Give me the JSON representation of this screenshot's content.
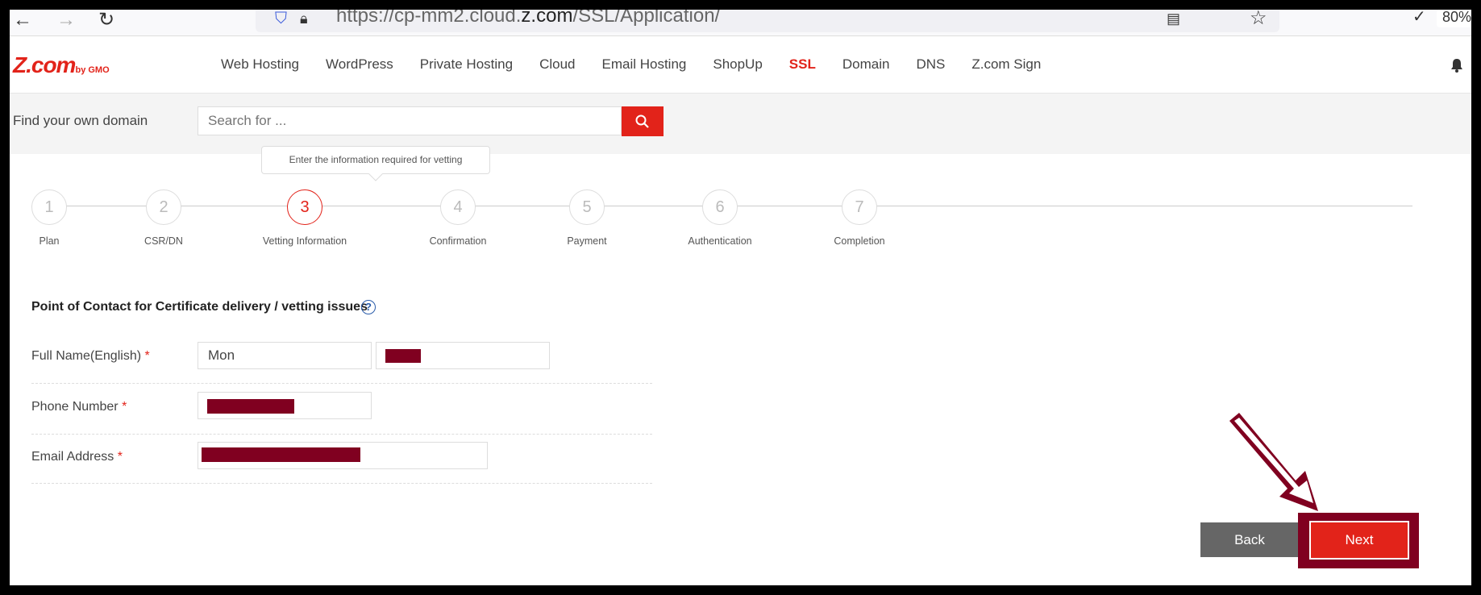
{
  "browser": {
    "url_prefix": "https://cp-mm2.cloud.",
    "url_domain": "z.com",
    "url_path": "/SSL/Application/",
    "zoom": "80%"
  },
  "header": {
    "logo_text": "Z.com",
    "logo_suffix": "by GMO",
    "nav": [
      "Web Hosting",
      "WordPress",
      "Private Hosting",
      "Cloud",
      "Email Hosting",
      "ShopUp",
      "SSL",
      "Domain",
      "DNS",
      "Z.com Sign"
    ],
    "active_nav": "SSL"
  },
  "search": {
    "label": "Find your own domain",
    "placeholder": "Search for ..."
  },
  "steps": {
    "tooltip": "Enter the information required for vetting",
    "items": [
      {
        "num": "1",
        "label": "Plan"
      },
      {
        "num": "2",
        "label": "CSR/DN"
      },
      {
        "num": "3",
        "label": "Vetting Information"
      },
      {
        "num": "4",
        "label": "Confirmation"
      },
      {
        "num": "5",
        "label": "Payment"
      },
      {
        "num": "6",
        "label": "Authentication"
      },
      {
        "num": "7",
        "label": "Completion"
      }
    ],
    "current": 3
  },
  "form": {
    "section_title": "Point of Contact for Certificate delivery / vetting issues",
    "help_icon_text": "?",
    "full_name_label": "Full Name(English)",
    "first_name_value": "Mon",
    "phone_label": "Phone Number",
    "email_label": "Email Address",
    "required_mark": "*"
  },
  "actions": {
    "back_label": "Back",
    "next_label": "Next"
  },
  "colors": {
    "brand_red": "#e2231a",
    "annotation": "#800020"
  }
}
